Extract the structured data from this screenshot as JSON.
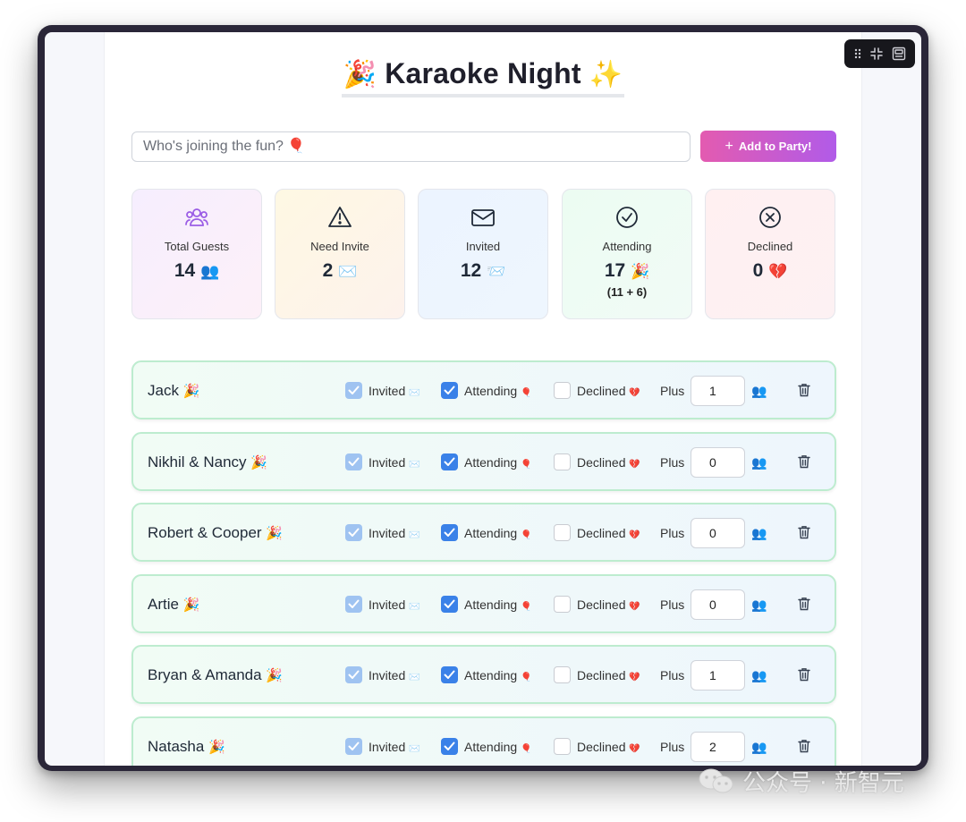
{
  "app": {
    "title": "Karaoke Night",
    "title_emoji_left": "🎉",
    "title_emoji_right": "✨"
  },
  "add_form": {
    "placeholder": "Who's joining the fun? 🎈",
    "button_label": "Add to Party!",
    "button_icon": "plus-icon"
  },
  "stats": {
    "total": {
      "label": "Total Guests",
      "value": "14",
      "emoji": "👥",
      "icon": "users-icon",
      "icon_color": "#9b5de5"
    },
    "need_invite": {
      "label": "Need Invite",
      "value": "2",
      "emoji": "✉️",
      "icon": "warning-icon",
      "icon_color": "#1f2937"
    },
    "invited": {
      "label": "Invited",
      "value": "12",
      "emoji": "📨",
      "icon": "mail-icon",
      "icon_color": "#1f2937"
    },
    "attending": {
      "label": "Attending",
      "value": "17",
      "emoji": "🎉",
      "sub": "(11 + 6)",
      "icon": "check-circle-icon",
      "icon_color": "#1f2937"
    },
    "declined": {
      "label": "Declined",
      "value": "0",
      "emoji": "💔",
      "icon": "x-circle-icon",
      "icon_color": "#1f2937"
    }
  },
  "labels": {
    "invited": "Invited",
    "invited_emoji": "✉️",
    "attending": "Attending",
    "attending_emoji": "🎈",
    "declined": "Declined",
    "declined_emoji": "💔",
    "plus": "Plus",
    "people_emoji": "👥"
  },
  "guests": [
    {
      "name": "Jack",
      "emoji": "🎉",
      "invited": true,
      "attending": true,
      "declined": false,
      "plus": "1"
    },
    {
      "name": "Nikhil & Nancy",
      "emoji": "🎉",
      "invited": true,
      "attending": true,
      "declined": false,
      "plus": "0"
    },
    {
      "name": "Robert & Cooper",
      "emoji": "🎉",
      "invited": true,
      "attending": true,
      "declined": false,
      "plus": "0"
    },
    {
      "name": "Artie",
      "emoji": "🎉",
      "invited": true,
      "attending": true,
      "declined": false,
      "plus": "0"
    },
    {
      "name": "Bryan & Amanda",
      "emoji": "🎉",
      "invited": true,
      "attending": true,
      "declined": false,
      "plus": "1"
    },
    {
      "name": "Natasha",
      "emoji": "🎉",
      "invited": true,
      "attending": true,
      "declined": false,
      "plus": "2"
    }
  ],
  "window_controls": [
    "drag-handle-icon",
    "minimize-icon",
    "screenshot-icon"
  ],
  "watermark": {
    "text": "公众号 · 新智元",
    "icon": "wechat-icon"
  },
  "colors": {
    "accent_start": "#e35bb0",
    "accent_end": "#b15be8",
    "checkbox_checked": "#3a81e8",
    "checkbox_disabled": "#9fc3f1",
    "guest_border": "#bdeccf"
  }
}
